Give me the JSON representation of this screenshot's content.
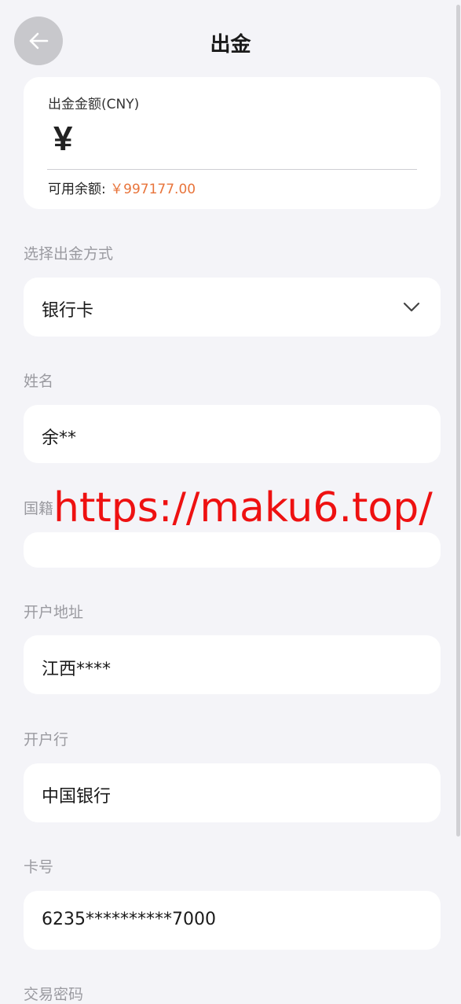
{
  "header": {
    "title": "出金",
    "back_icon": "arrow-left-icon"
  },
  "amount_card": {
    "label": "出金金额(CNY)",
    "currency_symbol": "¥",
    "amount_value": "",
    "balance_label": "可用余额:",
    "balance_value": "￥997177.00"
  },
  "withdraw_method": {
    "label": "选择出金方式",
    "selected": "银行卡",
    "icon": "chevron-down-icon"
  },
  "name": {
    "label": "姓名",
    "value": "余**"
  },
  "nationality": {
    "label": "国籍",
    "value": ""
  },
  "bank_address": {
    "label": "开户地址",
    "value": "江西****"
  },
  "bank": {
    "label": "开户行",
    "value": "中国银行"
  },
  "card_number": {
    "label": "卡号",
    "value": "6235**********7000"
  },
  "trade_password": {
    "label": "交易密码"
  },
  "watermark": "https://maku6.top/",
  "colors": {
    "background": "#f4f4f8",
    "balance_accent": "#e8743b",
    "watermark": "#ee1111"
  }
}
